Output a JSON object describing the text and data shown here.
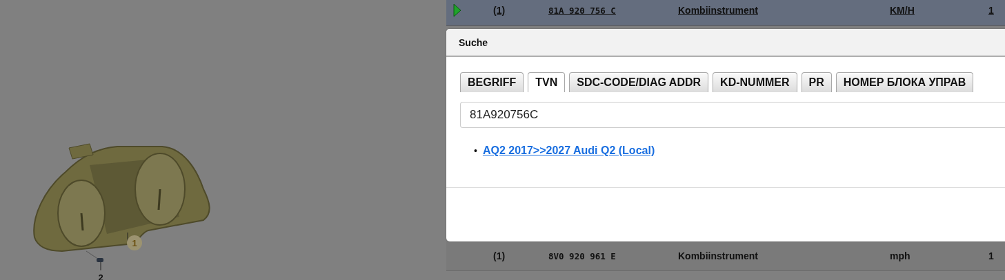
{
  "diagram": {
    "callouts": [
      {
        "label": "1",
        "kind": "highlighted"
      },
      {
        "label": "2",
        "kind": "plain"
      }
    ]
  },
  "parts_table": {
    "rows": [
      {
        "selected": true,
        "position": "(1)",
        "part_number": "81A 920 756 C",
        "name": "Kombiinstrument",
        "unit": "KM/H",
        "quantity": "1"
      },
      {
        "selected": false,
        "position": "(1)",
        "part_number": "8V0 920 961 E",
        "name": "Kombiinstrument",
        "unit": "mph",
        "quantity": "1"
      }
    ]
  },
  "dialog": {
    "title": "Suche",
    "tabs": [
      {
        "label": "BEGRIFF",
        "selected": false
      },
      {
        "label": "TVN",
        "selected": true
      },
      {
        "label": "SDC-CODE/DIAG ADDR",
        "selected": false
      },
      {
        "label": "KD-NUMMER",
        "selected": false
      },
      {
        "label": "PR",
        "selected": false
      },
      {
        "label": "НОМЕР БЛОКА УПРАВ",
        "selected": false
      }
    ],
    "search": {
      "value": "81A920756C"
    },
    "results": [
      {
        "bullet": "•",
        "label": "AQ2 2017>>2027 Audi Q2 (Local)"
      }
    ]
  }
}
